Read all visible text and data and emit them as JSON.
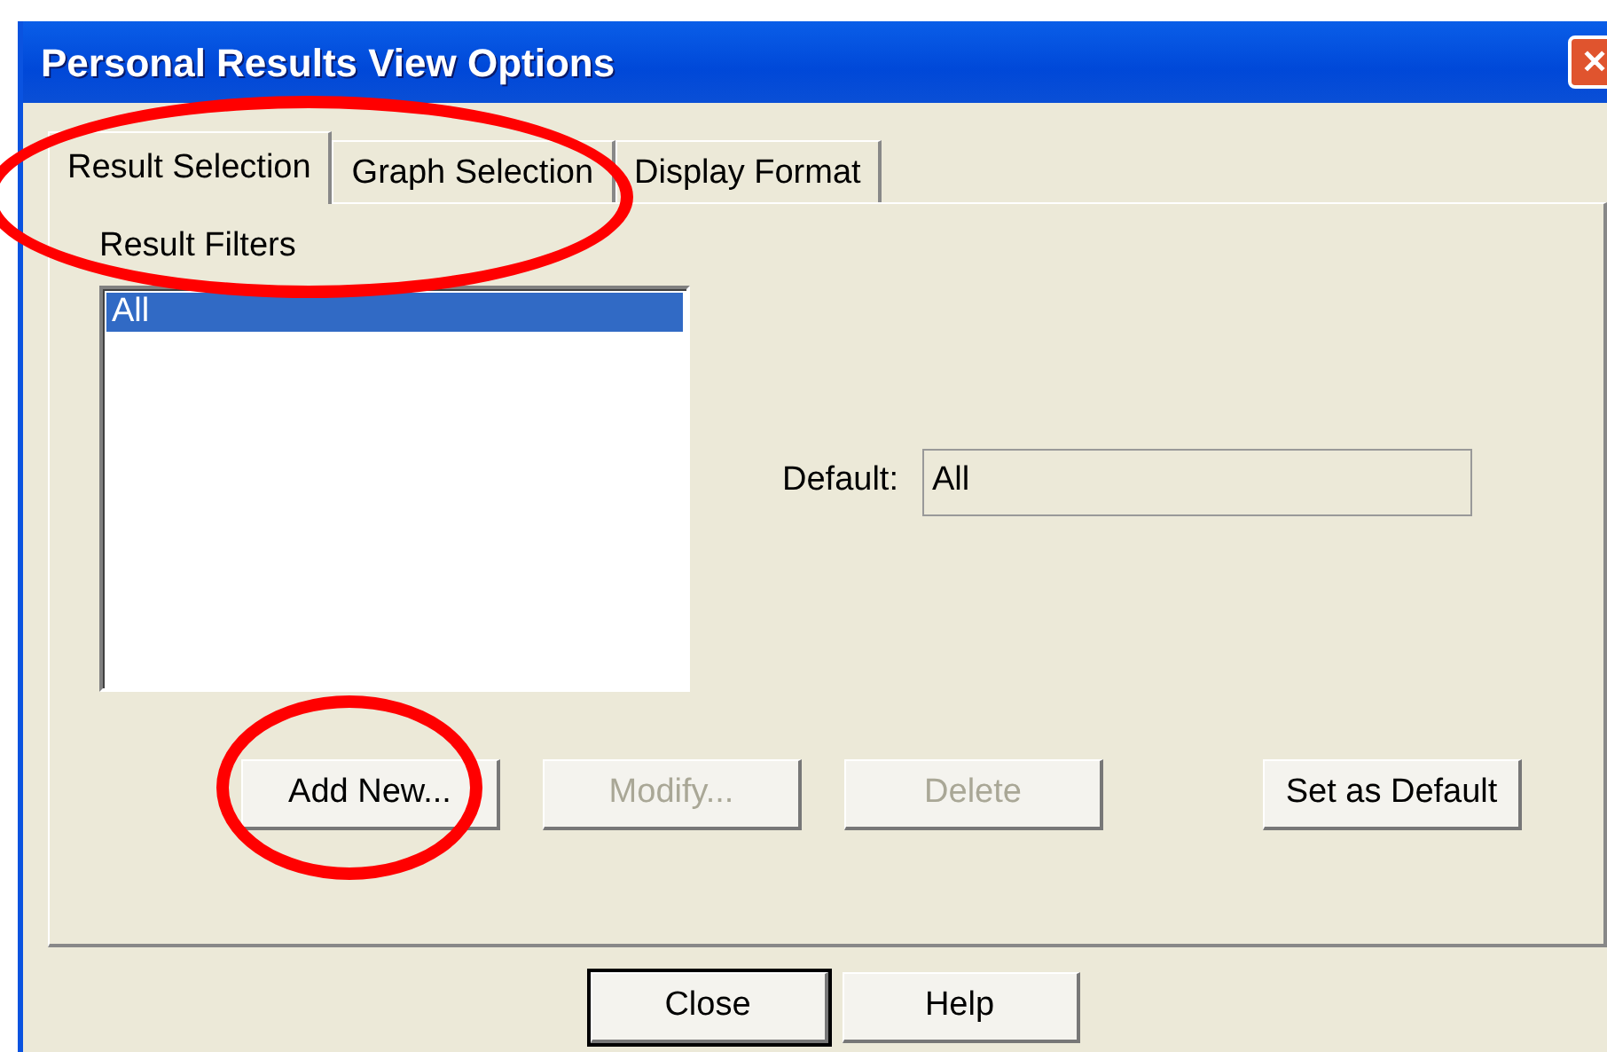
{
  "window": {
    "title": "Personal Results View Options",
    "close_symbol": "✕"
  },
  "tabs": {
    "circled": true,
    "items": [
      {
        "label": "Result Selection",
        "selected": true
      },
      {
        "label": "Graph Selection",
        "selected": false
      },
      {
        "label": "Display Format",
        "selected": false
      }
    ]
  },
  "result_filters": {
    "label": "Result Filters",
    "items": [
      {
        "label": "All",
        "selected": true
      }
    ]
  },
  "default": {
    "label": "Default:",
    "value": "All"
  },
  "panel_buttons": [
    {
      "label": "Add New...",
      "disabled": false,
      "circled": true
    },
    {
      "label": "Modify...",
      "disabled": true,
      "circled": false
    },
    {
      "label": "Delete",
      "disabled": true,
      "circled": false
    },
    {
      "label": "Set as Default",
      "disabled": false,
      "circled": false
    }
  ],
  "dialog_buttons": [
    {
      "label": "Close",
      "default": true
    },
    {
      "label": "Help",
      "default": false
    }
  ]
}
